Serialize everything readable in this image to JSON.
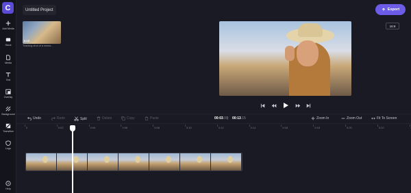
{
  "app": {
    "logo_letter": "C",
    "project_title": "Untitled Project",
    "export_label": "Export",
    "aspect_ratio": "16:9",
    "accent_color": "#6c5ce7"
  },
  "sidebar": {
    "items": [
      {
        "label": "Add Media",
        "icon": "plus-icon"
      },
      {
        "label": "Stock",
        "icon": "stock-icon"
      },
      {
        "label": "Media",
        "icon": "file-icon"
      },
      {
        "label": "Text",
        "icon": "text-icon"
      },
      {
        "label": "Overlay",
        "icon": "overlay-icon"
      },
      {
        "label": "Background",
        "icon": "background-icon"
      },
      {
        "label": "Transition",
        "icon": "transition-icon"
      },
      {
        "label": "Logo",
        "icon": "shield-icon"
      },
      {
        "label": "Help",
        "icon": "help-icon"
      }
    ]
  },
  "media": {
    "duration": "0:13",
    "caption": "Tracking shot of a woma..."
  },
  "toolbar": {
    "undo": "Undo",
    "redo": "Redo",
    "split": "Split",
    "delete": "Delete",
    "copy": "Copy",
    "paste": "Paste",
    "current_time": "00:03",
    "current_frac": ".00",
    "separator": "|",
    "total_time": "00:13",
    "total_frac": ".15",
    "zoom_in": "Zoom In",
    "zoom_out": "Zoom Out",
    "fit": "Fit To Screen"
  },
  "ruler": {
    "ticks": [
      "0",
      "0:02",
      "0:04",
      "0:06",
      "0:08",
      "0:10",
      "0:12",
      "0:14",
      "0:16",
      "0:18",
      "0:20",
      "0:22",
      "0:24"
    ]
  }
}
